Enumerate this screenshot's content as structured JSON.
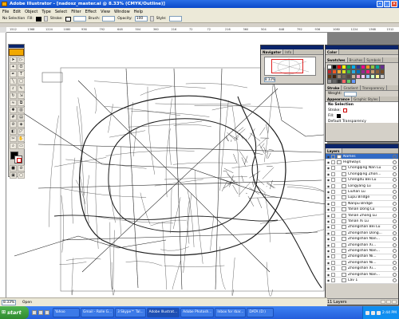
{
  "window": {
    "title": "Adobe Illustrator - [nadosz_master.ai @ 8.33% (CMYK/Outline)]"
  },
  "menu": [
    "File",
    "Edit",
    "Object",
    "Type",
    "Select",
    "Filter",
    "Effect",
    "View",
    "Window",
    "Help"
  ],
  "controlbar": {
    "selection": "No Selection",
    "fill_label": "Fill:",
    "stroke_label": "Stroke:",
    "brush_label": "Brush:",
    "opacity_label": "Opacity:",
    "opacity_value": "100",
    "style_label": "Style:"
  },
  "ruler": [
    "1512",
    "1368",
    "1224",
    "1080",
    "936",
    "792",
    "648",
    "504",
    "360",
    "216",
    "72",
    "72",
    "216",
    "360",
    "504",
    "648",
    "792",
    "936",
    "1080",
    "1224",
    "1368",
    "1512"
  ],
  "navigator": {
    "tabs": [
      "Navigator",
      "Info"
    ],
    "zoom": "8.33%"
  },
  "color_panel": {
    "tabs": [
      "Color"
    ]
  },
  "swatches": {
    "tabs": [
      "Swatches",
      "Brushes",
      "Symbols"
    ],
    "colors": [
      "#ffffff",
      "#000000",
      "#ff0000",
      "#ffff00",
      "#00a651",
      "#00aeef",
      "#2e3192",
      "#ec008c",
      "#f7941d",
      "#8dc63f",
      "#00a99d",
      "#662d91",
      "#c1272d",
      "#f15a24",
      "#fbb03b",
      "#d9e021",
      "#39b54a",
      "#29abe2",
      "#0071bc",
      "#93278f",
      "#ed1e79",
      "#c69c6d",
      "#8c6239",
      "#754c24",
      "#603813",
      "#42210b",
      "#998675",
      "#736357",
      "#534741",
      "#c7b299",
      "#ff99cc",
      "#ffccff",
      "#99ccff",
      "#ccffcc",
      "#ffff99",
      "#cccccc",
      "#999999",
      "#666666",
      "#333333",
      "#ff6666",
      "#66cc66",
      "#6699ff"
    ]
  },
  "stroke_panel": {
    "tabs": [
      "Stroke",
      "Gradient",
      "Transparency"
    ],
    "weight_label": "Weight:"
  },
  "appearance": {
    "tabs": [
      "Appearance",
      "Graphic Styles"
    ],
    "selection": "No Selection",
    "stroke_label": "Stroke:",
    "fill_label": "Fill:",
    "transparency": "Default Transparency"
  },
  "layers": {
    "tabs": [
      "Layers"
    ],
    "rows": [
      "Names",
      "Highways",
      "Chongqing Nan Lu",
      "Chongqing Zhon...",
      "Chengdu Bei Lu",
      "Longyang Lu",
      "Liuhan Lu",
      "Lupu Bridge",
      "Nanpu Bridge",
      "Yanan Dong Lu",
      "Yanan Zhong Lu",
      "Yanan Xi Lu",
      "Zhongshan Bei Lu",
      "Zhongshan Dong...",
      "Zhongshan Nan...",
      "Zhongshan Xi...",
      "Zhongshan Nan...",
      "Zhongshan Ni...",
      "Zhongshan Ni...",
      "Zhongshan Xi...",
      "Zhongshan Nan...",
      "Lav 1"
    ],
    "count": "11 Layers"
  },
  "status": {
    "zoom": "8.33%",
    "info": "Open"
  },
  "taskbar": {
    "start": "start",
    "tasks": [
      "Yahoo",
      "Gmail - Rolle G...",
      "3 Skype™ Tal...",
      "Adobe Illustrat...",
      "Adobe Photosh...",
      "Inbox for rbar...",
      "DATA (D:)"
    ],
    "clock": "2:44 PM"
  }
}
